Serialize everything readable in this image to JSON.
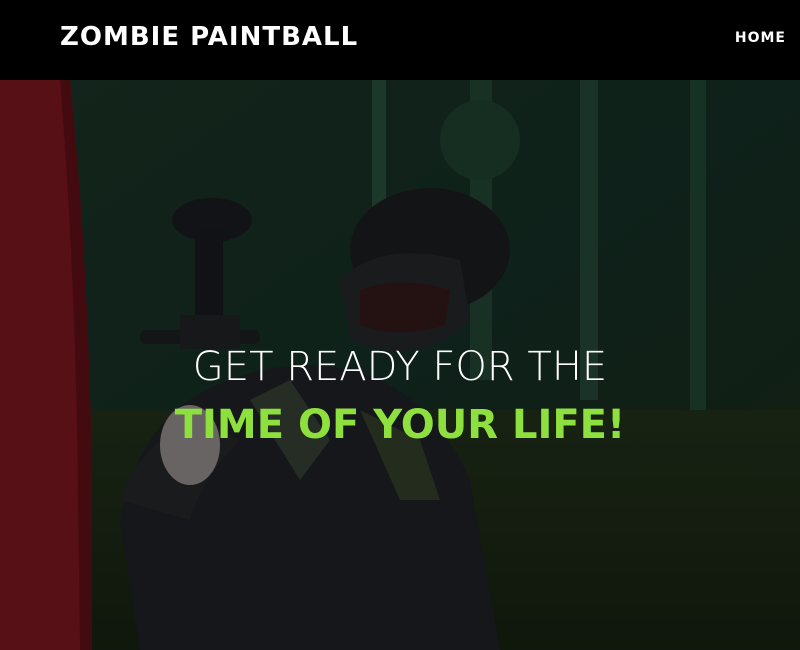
{
  "navbar": {
    "brand": "ZOMBIE PAINTBALL",
    "links": [
      {
        "label": "HOME"
      }
    ]
  },
  "hero": {
    "headline_line1": "GET READY FOR THE",
    "headline_line2": "TIME OF YOUR LIFE!",
    "image_subject": "paintball player in mask aiming marker behind red barricade",
    "accent_color": "#8ee03f",
    "overlay_color": "#000000"
  }
}
